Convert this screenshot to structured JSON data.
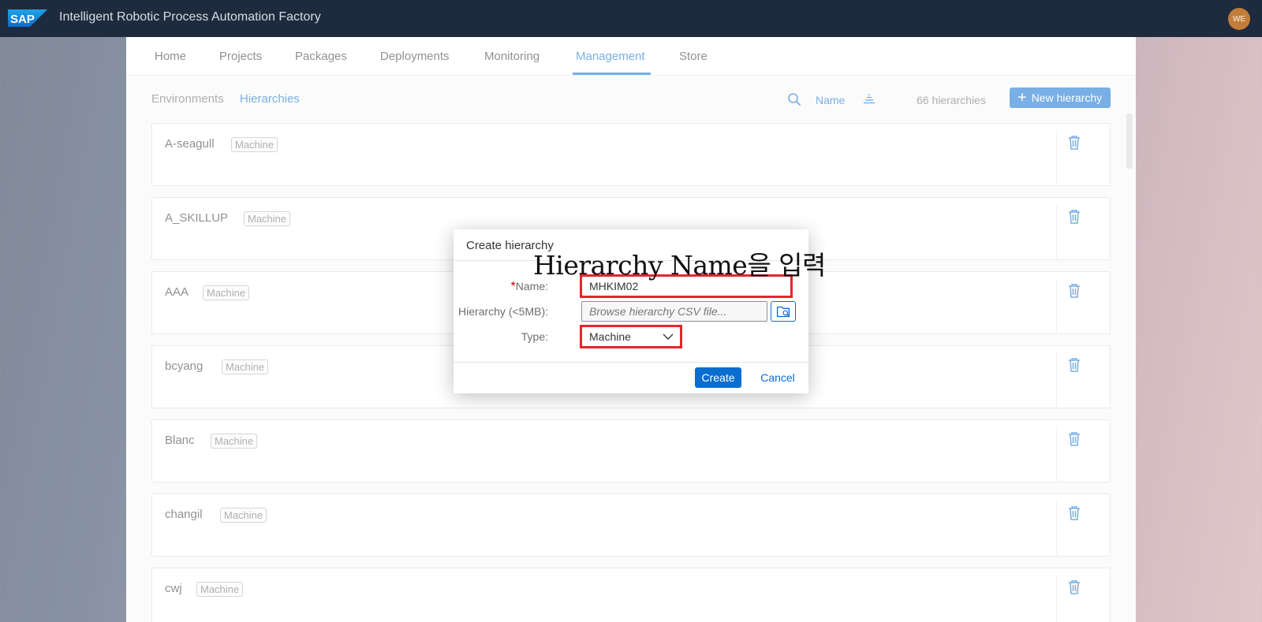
{
  "shell": {
    "logo_text": "SAP",
    "title": "Intelligent Robotic Process Automation Factory",
    "avatar_initials": "WE"
  },
  "nav": {
    "tabs": [
      "Home",
      "Projects",
      "Packages",
      "Deployments",
      "Monitoring",
      "Management",
      "Store"
    ],
    "active_tab": "Management"
  },
  "subnav": {
    "tabs": [
      "Environments",
      "Hierarchies"
    ],
    "active_tab": "Hierarchies",
    "sort_label": "Name",
    "count_text": "66 hierarchies",
    "new_button_label": "New hierarchy"
  },
  "hierarchies": [
    {
      "name": "A-seagull",
      "type": "Machine"
    },
    {
      "name": "A_SKILLUP",
      "type": "Machine"
    },
    {
      "name": "AAA",
      "type": "Machine"
    },
    {
      "name": "bcyang",
      "type": "Machine"
    },
    {
      "name": "Blanc",
      "type": "Machine"
    },
    {
      "name": "changil",
      "type": "Machine"
    },
    {
      "name": "cwj",
      "type": "Machine"
    }
  ],
  "dialog": {
    "title": "Create hierarchy",
    "name_label": "Name:",
    "name_required_mark": "*",
    "name_value": "MHKIM02",
    "hierarchy_label": "Hierarchy (<5MB):",
    "hierarchy_placeholder": "Browse hierarchy CSV file...",
    "type_label": "Type:",
    "type_value": "Machine",
    "create_label": "Create",
    "cancel_label": "Cancel"
  },
  "annotation_text": "Hierarchy Name을 입력",
  "colors": {
    "accent": "#0a6ed1",
    "shellbar": "#1e2b3e",
    "highlight": "#e8242c"
  }
}
